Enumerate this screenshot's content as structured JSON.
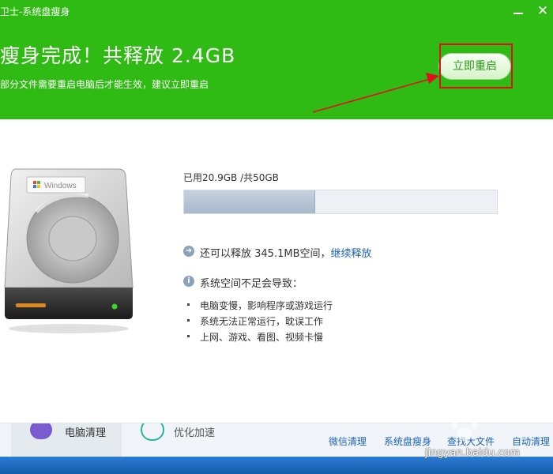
{
  "window": {
    "title": "卫士-系统盘瘦身",
    "minimize_label": "",
    "close_label": "✕"
  },
  "result": {
    "headline": "瘦身完成！共释放 2.4GB",
    "subline": "部分文件需要重启电脑后才能生效，建议立即重启",
    "restart_button": "立即重启"
  },
  "disk": {
    "brand_label": "Windows",
    "usage_text": "已用20.9GB /共50GB",
    "used_gb": 20.9,
    "total_gb": 50
  },
  "info": {
    "free_more_text": "还可以释放 345.1MB空间，",
    "continue_link": "继续释放",
    "warning_title": "系统空间不足会导致：",
    "warnings": [
      "电脑变慢，影响程序或游戏运行",
      "系统无法正常运行，耽误工作",
      "上网、游戏、看图、视频卡慢"
    ]
  },
  "bottom": {
    "tabs": [
      "电脑清理",
      "优化加速"
    ],
    "links": [
      "微信清理",
      "系统盘瘦身",
      "查找大文件",
      "自动清理"
    ]
  },
  "watermark": "jingyan.baidu.com",
  "colors": {
    "header_green": "#2fba14",
    "accent_red": "#e0101c",
    "link_blue": "#1c62b8"
  },
  "icons": {
    "minimize": "minimize-icon",
    "close": "close-icon",
    "arrow": "arrow-right-circle-icon",
    "info": "info-circle-icon"
  }
}
